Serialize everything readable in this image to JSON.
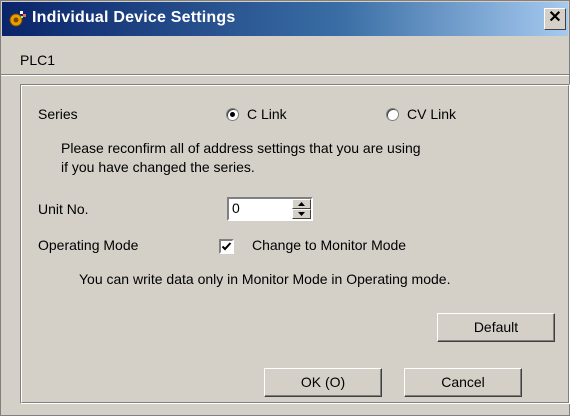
{
  "window": {
    "title": "Individual Device Settings",
    "close_glyph": "✕"
  },
  "plc_label": "PLC1",
  "series": {
    "label": "Series",
    "options": [
      {
        "label": "C Link",
        "selected": true
      },
      {
        "label": "CV Link",
        "selected": false
      }
    ],
    "note_line1": "Please reconfirm all of address settings that you are using",
    "note_line2": "if you have changed the series."
  },
  "unit_no": {
    "label": "Unit No.",
    "value": "0"
  },
  "operating_mode": {
    "label": "Operating Mode",
    "checkbox_label": "Change to Monitor Mode",
    "checked": true,
    "note": "You can write data only in Monitor Mode in Operating mode."
  },
  "buttons": {
    "default": "Default",
    "ok": "OK (O)",
    "cancel": "Cancel"
  },
  "icons": {
    "title": "settings-sparkle-icon",
    "close": "close-icon",
    "spin_up": "up-arrow-icon",
    "spin_down": "down-arrow-icon",
    "check": "check-icon"
  }
}
